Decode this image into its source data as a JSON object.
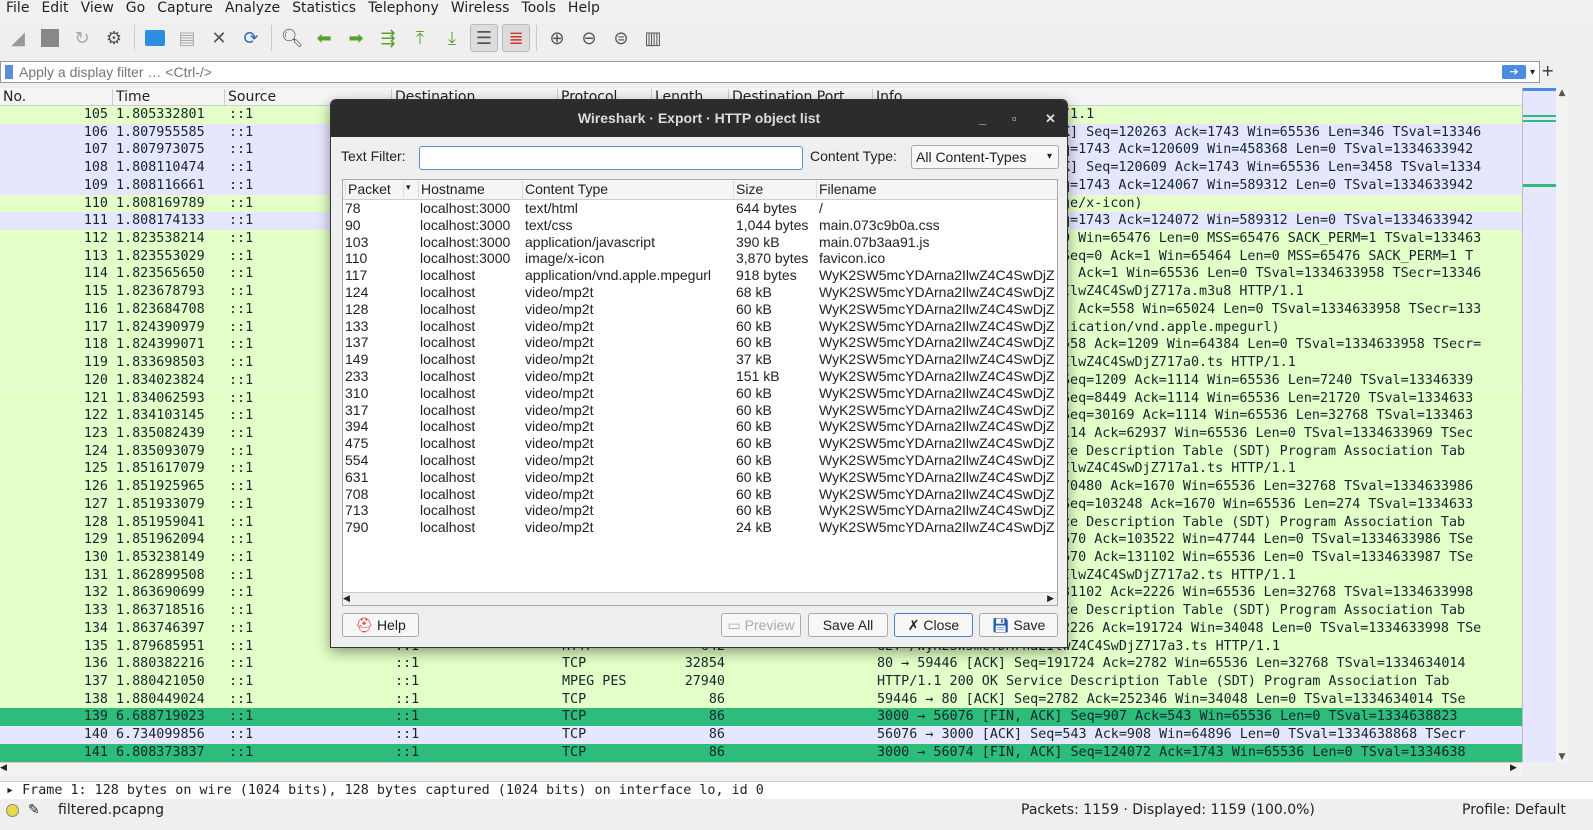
{
  "menu": [
    "File",
    "Edit",
    "View",
    "Go",
    "Capture",
    "Analyze",
    "Statistics",
    "Telephony",
    "Wireless",
    "Tools",
    "Help"
  ],
  "filter": {
    "placeholder": "Apply a display filter … <Ctrl-/>"
  },
  "columns": [
    "No.",
    "Time",
    "Source",
    "Destination",
    "Protocol",
    "Length",
    "Destination Port",
    "Info"
  ],
  "colors": {
    "http": "#e4ffc7",
    "tcp": "#e7e6ff",
    "fin": "#2dbc7a"
  },
  "packets": [
    {
      "no": "105",
      "time": "1.805332801",
      "src": "::1",
      "c": "g",
      "info": "/1.1",
      "clip": true
    },
    {
      "no": "106",
      "time": "1.807955585",
      "src": "::1",
      "c": "l",
      "info": "K] Seq=120263 Ack=1743 Win=65536 Len=346 TSval=13346",
      "clip": true
    },
    {
      "no": "107",
      "time": "1.807973075",
      "src": "::1",
      "c": "l",
      "info": "q=1743 Ack=120609 Win=458368 Len=0 TSval=1334633942",
      "clip": true
    },
    {
      "no": "108",
      "time": "1.808110474",
      "src": "::1",
      "c": "l",
      "info": "K] Seq=120609 Ack=1743 Win=65536 Len=3458 TSval=1334",
      "clip": true
    },
    {
      "no": "109",
      "time": "1.808116661",
      "src": "::1",
      "c": "l",
      "info": "q=1743 Ack=124067 Win=589312 Len=0 TSval=1334633942",
      "clip": true
    },
    {
      "no": "110",
      "time": "1.808169789",
      "src": "::1",
      "c": "g",
      "info": "ge/x-icon)",
      "clip": true
    },
    {
      "no": "111",
      "time": "1.808174133",
      "src": "::1",
      "c": "l",
      "info": "q=1743 Ack=124072 Win=589312 Len=0 TSval=1334633942",
      "clip": true
    },
    {
      "no": "112",
      "time": "1.823538214",
      "src": "::1",
      "c": "g",
      "info": "0 Win=65476 Len=0 MSS=65476 SACK_PERM=1 TSval=133463",
      "clip": true
    },
    {
      "no": "113",
      "time": "1.823553029",
      "src": "::1",
      "c": "g",
      "info": " Seq=0 Ack=1 Win=65464 Len=0 MSS=65476 SACK_PERM=1 T",
      "clip": true
    },
    {
      "no": "114",
      "time": "1.823565650",
      "src": "::1",
      "c": "g",
      "info": "] Ack=1 Win=65536 Len=0 TSval=1334633958 TSecr=13346",
      "clip": true
    },
    {
      "no": "115",
      "time": "1.823678793",
      "src": "::1",
      "c": "g",
      "info": "IlwZ4C4SwDjZ717a.m3u8 HTTP/1.1",
      "clip": true
    },
    {
      "no": "116",
      "time": "1.823684708",
      "src": "::1",
      "c": "g",
      "info": "] Ack=558 Win=65024 Len=0 TSval=1334633958 TSecr=133",
      "clip": true
    },
    {
      "no": "117",
      "time": "1.824390979",
      "src": "::1",
      "c": "g",
      "info": "lication/vnd.apple.mpegurl)",
      "clip": true
    },
    {
      "no": "118",
      "time": "1.824399071",
      "src": "::1",
      "c": "g",
      "info": "558 Ack=1209 Win=64384 Len=0 TSval=1334633958 TSecr=",
      "clip": true
    },
    {
      "no": "119",
      "time": "1.833698503",
      "src": "::1",
      "c": "g",
      "info": "IlwZ4C4SwDjZ717a0.ts HTTP/1.1",
      "clip": true
    },
    {
      "no": "120",
      "time": "1.834023824",
      "src": "::1",
      "c": "g",
      "info": " Seq=1209 Ack=1114 Win=65536 Len=7240 TSval=13346339",
      "clip": true
    },
    {
      "no": "121",
      "time": "1.834062593",
      "src": "::1",
      "c": "g",
      "info": " Seq=8449 Ack=1114 Win=65536 Len=21720 TSval=1334633",
      "clip": true
    },
    {
      "no": "122",
      "time": "1.834103145",
      "src": "::1",
      "c": "g",
      "info": " Seq=30169 Ack=1114 Win=65536 Len=32768 TSval=133463",
      "clip": true
    },
    {
      "no": "123",
      "time": "1.835082439",
      "src": "::1",
      "c": "g",
      "info": "114 Ack=62937 Win=65536 Len=0 TSval=1334633969 TSec",
      "clip": true
    },
    {
      "no": "124",
      "time": "1.835093079",
      "src": "::1",
      "c": "g",
      "info": "ce Description Table (SDT)  Program Association Tab",
      "clip": true
    },
    {
      "no": "125",
      "time": "1.851617079",
      "src": "::1",
      "c": "g",
      "info": "IlwZ4C4SwDjZ717a1.ts HTTP/1.1",
      "clip": true
    },
    {
      "no": "126",
      "time": "1.851925965",
      "src": "::1",
      "c": "g",
      "info": "70480 Ack=1670 Win=65536 Len=32768 TSval=1334633986",
      "clip": true
    },
    {
      "no": "127",
      "time": "1.851933079",
      "src": "::1",
      "c": "g",
      "info": " Seq=103248 Ack=1670 Win=65536 Len=274 TSval=1334633",
      "clip": true
    },
    {
      "no": "128",
      "time": "1.851959041",
      "src": "::1",
      "c": "g",
      "info": "ce Description Table (SDT)  Program Association Tab",
      "clip": true
    },
    {
      "no": "129",
      "time": "1.851962094",
      "src": "::1",
      "c": "g",
      "info": "670 Ack=103522 Win=47744 Len=0 TSval=1334633986 TSe",
      "clip": true
    },
    {
      "no": "130",
      "time": "1.853238149",
      "src": "::1",
      "c": "g",
      "info": "670 Ack=131102 Win=65536 Len=0 TSval=1334633987 TSe",
      "clip": true
    },
    {
      "no": "131",
      "time": "1.862899508",
      "src": "::1",
      "c": "g",
      "info": "IlwZ4C4SwDjZ717a2.ts HTTP/1.1",
      "clip": true
    },
    {
      "no": "132",
      "time": "1.863690699",
      "src": "::1",
      "c": "g",
      "info": "31102 Ack=2226 Win=65536 Len=32768 TSval=1334633998",
      "clip": true
    },
    {
      "no": "133",
      "time": "1.863718516",
      "src": "::1",
      "c": "g",
      "info": "ce Description Table (SDT)  Program Association Tab",
      "clip": true
    },
    {
      "no": "134",
      "time": "1.863746397",
      "src": "::1",
      "c": "g",
      "info": "2226 Ack=191724 Win=34048 Len=0 TSval=1334633998 TSe",
      "clip": true
    },
    {
      "no": "135",
      "time": "1.879685951",
      "src": "::1",
      "dst": "::1",
      "proto": "HTTP",
      "len": "642",
      "c": "g",
      "info": "GET /WyK2SW5mcYDArna2IlwZ4C4SwDjZ717a3.ts HTTP/1.1"
    },
    {
      "no": "136",
      "time": "1.880382216",
      "src": "::1",
      "dst": "::1",
      "proto": "TCP",
      "len": "32854",
      "c": "g",
      "info": "80 → 59446 [ACK] Seq=191724 Ack=2782 Win=65536 Len=32768 TSval=1334634014"
    },
    {
      "no": "137",
      "time": "1.880421050",
      "src": "::1",
      "dst": "::1",
      "proto": "MPEG PES",
      "len": "27940",
      "c": "g",
      "info": "HTTP/1.1 200 OK  Service Description Table (SDT)  Program Association Tab"
    },
    {
      "no": "138",
      "time": "1.880449024",
      "src": "::1",
      "dst": "::1",
      "proto": "TCP",
      "len": "86",
      "c": "g",
      "info": "59446 → 80 [ACK] Seq=2782 Ack=252346 Win=34048 Len=0 TSval=1334634014 TSe"
    },
    {
      "no": "139",
      "time": "6.688719023",
      "src": "::1",
      "dst": "::1",
      "proto": "TCP",
      "len": "86",
      "c": "d",
      "info": "3000 → 56076 [FIN, ACK] Seq=907 Ack=543 Win=65536 Len=0 TSval=1334638823"
    },
    {
      "no": "140",
      "time": "6.734099856",
      "src": "::1",
      "dst": "::1",
      "proto": "TCP",
      "len": "86",
      "c": "l",
      "info": "56076 → 3000 [ACK] Seq=543 Ack=908 Win=64896 Len=0 TSval=1334638868 TSecr"
    },
    {
      "no": "141",
      "time": "6.808373837",
      "src": "::1",
      "dst": "::1",
      "proto": "TCP",
      "len": "86",
      "c": "d",
      "info": "3000 → 56074 [FIN, ACK] Seq=124072 Ack=1743 Win=65536 Len=0 TSval=1334638"
    }
  ],
  "detail": "Frame 1: 128 bytes on wire (1024 bits), 128 bytes captured (1024 bits) on interface lo, id 0",
  "status": {
    "file": "filtered.pcapng",
    "packets": "Packets: 1159 · Displayed: 1159 (100.0%)",
    "profile": "Profile: Default"
  },
  "dialog": {
    "title": "Wireshark · Export · HTTP object list",
    "text_filter_label": "Text Filter:",
    "text_filter_value": "",
    "content_type_label": "Content Type:",
    "content_type_value": "All Content-Types",
    "columns": [
      "Packet",
      "Hostname",
      "Content Type",
      "Size",
      "Filename"
    ],
    "objects": [
      [
        "78",
        "localhost:3000",
        "text/html",
        "644 bytes",
        "/"
      ],
      [
        "90",
        "localhost:3000",
        "text/css",
        "1,044 bytes",
        "main.073c9b0a.css"
      ],
      [
        "103",
        "localhost:3000",
        "application/javascript",
        "390 kB",
        "main.07b3aa91.js"
      ],
      [
        "110",
        "localhost:3000",
        "image/x-icon",
        "3,870 bytes",
        "favicon.ico"
      ],
      [
        "117",
        "localhost",
        "application/vnd.apple.mpegurl",
        "918 bytes",
        "WyK2SW5mcYDArna2IlwZ4C4SwDjZ"
      ],
      [
        "124",
        "localhost",
        "video/mp2t",
        "68 kB",
        "WyK2SW5mcYDArna2IlwZ4C4SwDjZ"
      ],
      [
        "128",
        "localhost",
        "video/mp2t",
        "60 kB",
        "WyK2SW5mcYDArna2IlwZ4C4SwDjZ"
      ],
      [
        "133",
        "localhost",
        "video/mp2t",
        "60 kB",
        "WyK2SW5mcYDArna2IlwZ4C4SwDjZ"
      ],
      [
        "137",
        "localhost",
        "video/mp2t",
        "60 kB",
        "WyK2SW5mcYDArna2IlwZ4C4SwDjZ"
      ],
      [
        "149",
        "localhost",
        "video/mp2t",
        "37 kB",
        "WyK2SW5mcYDArna2IlwZ4C4SwDjZ"
      ],
      [
        "233",
        "localhost",
        "video/mp2t",
        "151 kB",
        "WyK2SW5mcYDArna2IlwZ4C4SwDjZ"
      ],
      [
        "310",
        "localhost",
        "video/mp2t",
        "60 kB",
        "WyK2SW5mcYDArna2IlwZ4C4SwDjZ"
      ],
      [
        "317",
        "localhost",
        "video/mp2t",
        "60 kB",
        "WyK2SW5mcYDArna2IlwZ4C4SwDjZ"
      ],
      [
        "394",
        "localhost",
        "video/mp2t",
        "60 kB",
        "WyK2SW5mcYDArna2IlwZ4C4SwDjZ"
      ],
      [
        "475",
        "localhost",
        "video/mp2t",
        "60 kB",
        "WyK2SW5mcYDArna2IlwZ4C4SwDjZ"
      ],
      [
        "554",
        "localhost",
        "video/mp2t",
        "60 kB",
        "WyK2SW5mcYDArna2IlwZ4C4SwDjZ"
      ],
      [
        "631",
        "localhost",
        "video/mp2t",
        "60 kB",
        "WyK2SW5mcYDArna2IlwZ4C4SwDjZ"
      ],
      [
        "708",
        "localhost",
        "video/mp2t",
        "60 kB",
        "WyK2SW5mcYDArna2IlwZ4C4SwDjZ"
      ],
      [
        "713",
        "localhost",
        "video/mp2t",
        "60 kB",
        "WyK2SW5mcYDArna2IlwZ4C4SwDjZ"
      ],
      [
        "790",
        "localhost",
        "video/mp2t",
        "24 kB",
        "WyK2SW5mcYDArna2IlwZ4C4SwDjZ"
      ]
    ],
    "buttons": {
      "help": "Help",
      "preview": "Preview",
      "save_all": "Save All",
      "close": "Close",
      "save": "Save"
    }
  }
}
